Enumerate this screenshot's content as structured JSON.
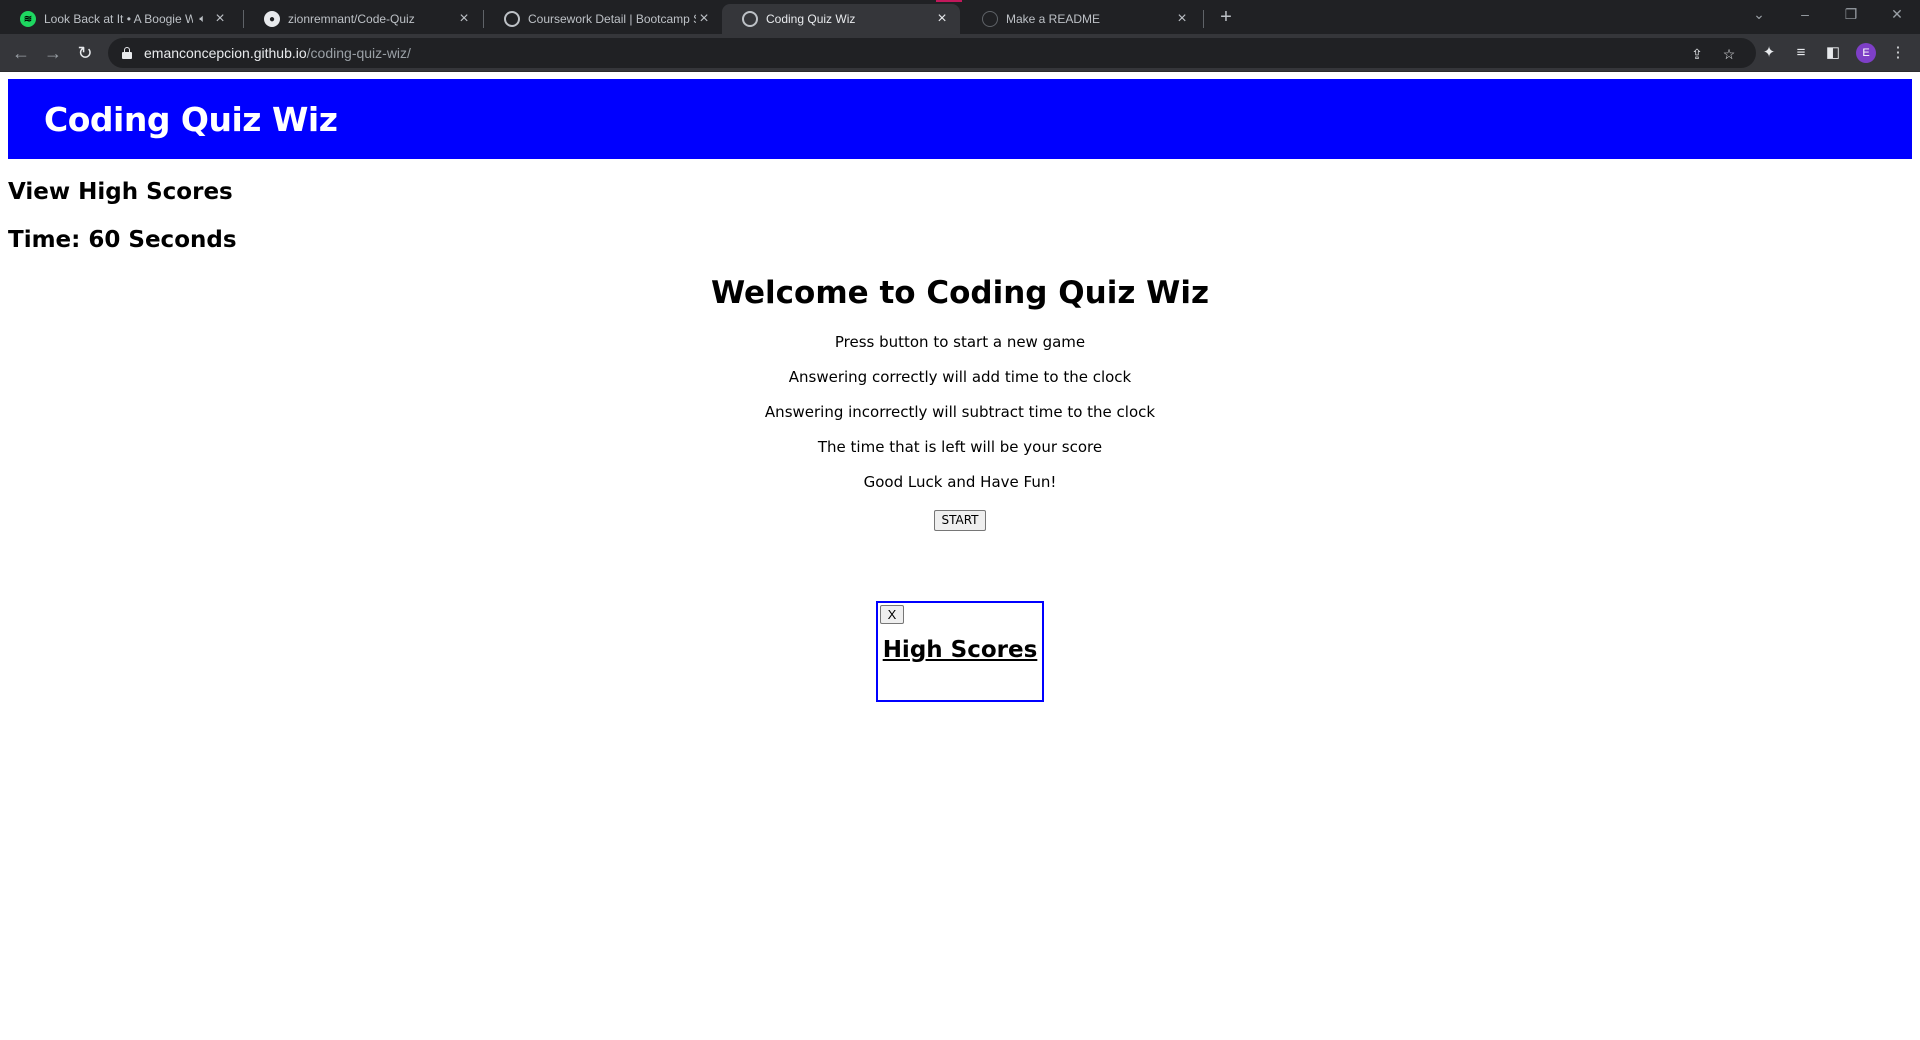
{
  "browser": {
    "tabs": [
      {
        "title": "Look Back at It • A Boogie W",
        "favicon": "spotify-icon",
        "audio": true,
        "active": false
      },
      {
        "title": "zionremnant/Code-Quiz",
        "favicon": "github-icon",
        "audio": false,
        "active": false
      },
      {
        "title": "Coursework Detail | Bootcamp Sp",
        "favicon": "globe-icon",
        "audio": false,
        "active": false
      },
      {
        "title": "Coding Quiz Wiz",
        "favicon": "globe-icon",
        "audio": false,
        "active": true
      },
      {
        "title": "Make a README",
        "favicon": "blank-page-icon",
        "audio": false,
        "active": false
      }
    ],
    "url_host": "emanconcepcion.github.io",
    "url_path": "/coding-quiz-wiz/",
    "profile_initial": "E",
    "accent_color": "#c2185b",
    "profile_color": "#7e3fc7"
  },
  "page": {
    "site_title": "Coding Quiz Wiz",
    "header_color": "#0000ff",
    "view_high_scores": "View High Scores",
    "timer_label": "Time:",
    "timer_value": "60",
    "timer_unit": "Seconds",
    "welcome_title": "Welcome to Coding Quiz Wiz",
    "instructions": [
      "Press button to start a new game",
      "Answering correctly will add time to the clock",
      "Answering incorrectly will subtract time to the clock",
      "The time that is left will be your score",
      "Good Luck and Have Fun!"
    ],
    "start_label": "START",
    "high_scores": {
      "close_label": "X",
      "title": "High Scores",
      "border_color": "#0000ff"
    }
  }
}
